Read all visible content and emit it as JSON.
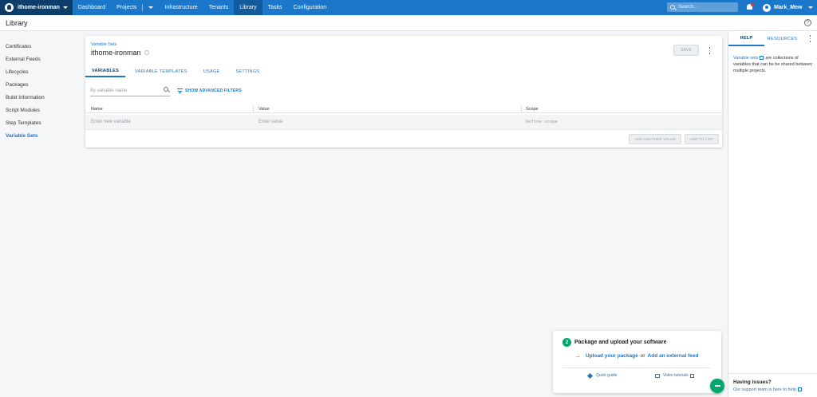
{
  "nav": {
    "space": "ithome-ironman",
    "items": [
      "Dashboard",
      "Projects",
      "Infrastructure",
      "Tenants",
      "Library",
      "Tasks",
      "Configuration"
    ],
    "active": "Library",
    "search_placeholder": "Search...",
    "user": "Mark_Mew"
  },
  "page": {
    "title": "Library"
  },
  "sidebar": {
    "items": [
      "Certificates",
      "External Feeds",
      "Lifecycles",
      "Packages",
      "Build Information",
      "Script Modules",
      "Step Templates",
      "Variable Sets"
    ],
    "active": "Variable Sets"
  },
  "card": {
    "breadcrumb": "Variable Sets",
    "title": "ithome-ironman",
    "save_label": "SAVE",
    "tabs": [
      "VARIABLES",
      "VARIABLE TEMPLATES",
      "USAGE",
      "SETTINGS"
    ],
    "active_tab": "VARIABLES",
    "filter_placeholder": "By variable name",
    "advanced_filters": "SHOW ADVANCED FILTERS",
    "columns": [
      "Name",
      "Value",
      "Scope"
    ],
    "new_row": {
      "name_placeholder": "Enter new variable",
      "value_placeholder": "Enter value",
      "scope_placeholder": "Define scope"
    },
    "add_another_value": "ADD ANOTHER VALUE",
    "add_to_list": "ADD TO LIST"
  },
  "help_panel": {
    "tabs": [
      "HELP",
      "RESOURCES"
    ],
    "active_tab": "HELP",
    "link_text": "Variable sets",
    "body_text": "are collections of variables that can be be shared between multiple projects.",
    "footer_title": "Having issues?",
    "footer_link": "Our support team is here to help"
  },
  "getting_started": {
    "step_number": "2",
    "title": "Package and upload your software",
    "upload_link": "Upload your package",
    "or_text": "or",
    "feed_link": "Add an external feed",
    "quick_guide": "Quick guide",
    "video_tutorials": "Video tutorials"
  },
  "colors": {
    "nav_blue": "#1a77ca",
    "space_dark": "#0d3e6b",
    "accent_green": "#00a86b"
  }
}
